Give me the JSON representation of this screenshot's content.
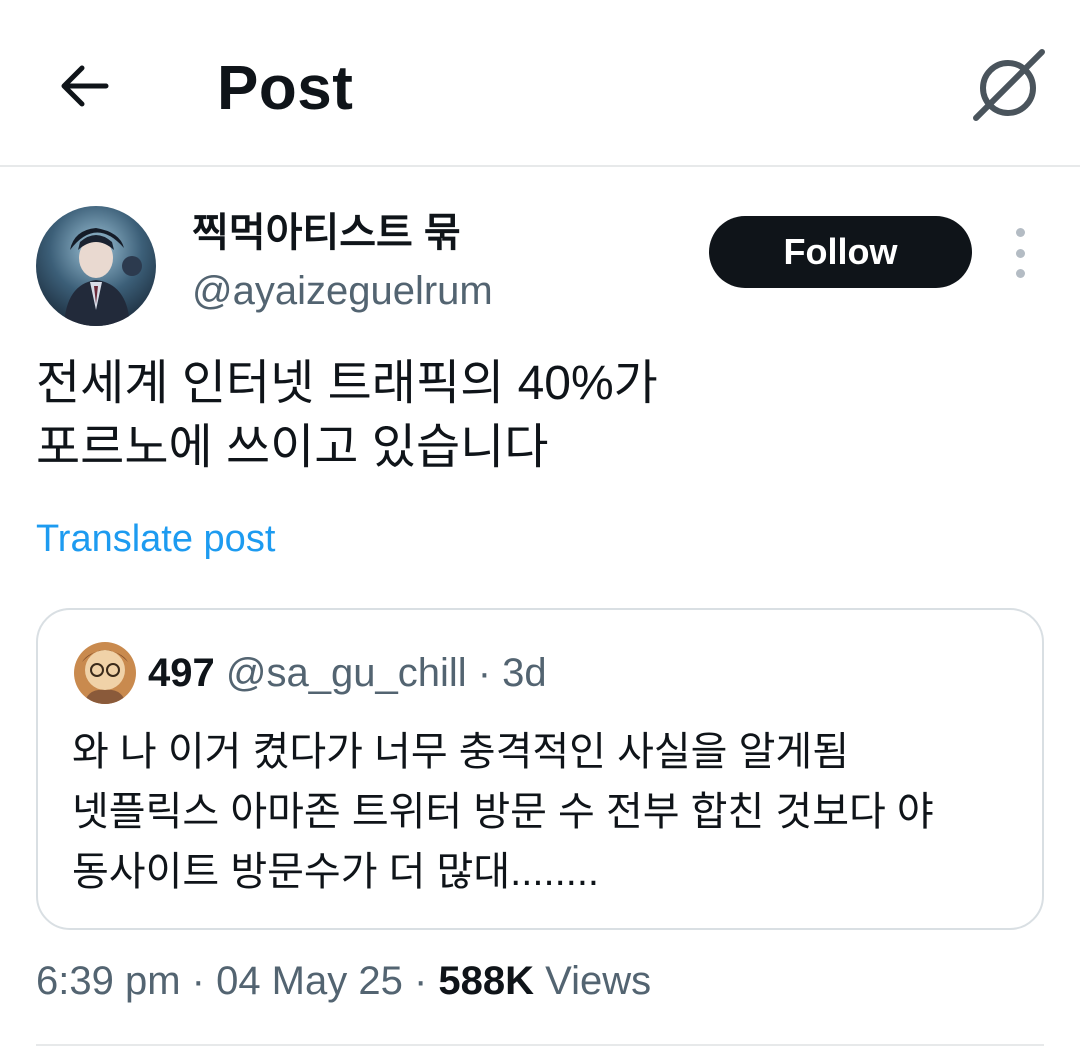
{
  "header": {
    "title": "Post",
    "back_icon": "arrow-left-icon",
    "grok_icon": "grok-icon"
  },
  "post": {
    "author": {
      "display_name": "찍먹아티스트 묶",
      "handle": "@ayaizeguelrum"
    },
    "follow_label": "Follow",
    "text_lines": [
      "전세계 인터넷 트래픽의 40%가",
      "포르노에 쓰이고 있습니다"
    ],
    "translate_label": "Translate post",
    "quote": {
      "display_name": "497",
      "handle": "@sa_gu_chill",
      "separator": " · ",
      "age": "3d",
      "text_lines": [
        "와 나 이거 켰다가 너무 충격적인 사실을 알게됨",
        "넷플릭스 아마존 트위터 방문 수 전부 합친 것보다 야",
        "동사이트 방문수가 더 많대........"
      ]
    },
    "meta": {
      "time": "6:39 pm",
      "separator": " · ",
      "date": "04 May 25",
      "views_count": "588K",
      "views_label": "Views"
    }
  },
  "colors": {
    "text": "#0f1419",
    "secondary": "#536471",
    "link": "#1d9bf0",
    "button_bg": "#0f1419",
    "border": "#d9dfe3"
  }
}
